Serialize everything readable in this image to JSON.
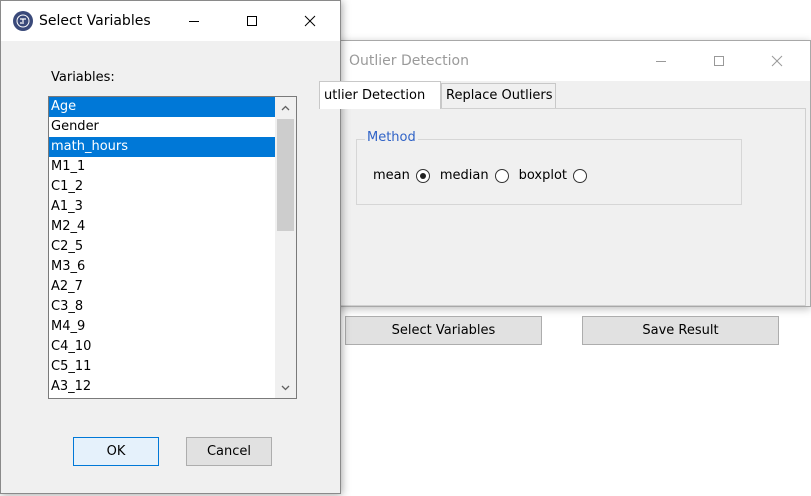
{
  "outlier_window": {
    "title": "Outlier Detection",
    "tabs": [
      {
        "label": "utlier Detection",
        "active": true
      },
      {
        "label": "Replace Outliers",
        "active": false
      }
    ],
    "method_group": {
      "title": "Method",
      "options": [
        {
          "label": "mean",
          "selected": true
        },
        {
          "label": "median",
          "selected": false
        },
        {
          "label": "boxplot",
          "selected": false
        }
      ]
    },
    "select_variables_label": "Select Variables",
    "save_result_label": "Save Result"
  },
  "select_window": {
    "title": "Select Variables",
    "variables_label": "Variables:",
    "variables": [
      {
        "name": "Age",
        "selected": true
      },
      {
        "name": "Gender",
        "selected": false
      },
      {
        "name": "math_hours",
        "selected": true
      },
      {
        "name": "M1_1",
        "selected": false
      },
      {
        "name": "C1_2",
        "selected": false
      },
      {
        "name": "A1_3",
        "selected": false
      },
      {
        "name": "M2_4",
        "selected": false
      },
      {
        "name": "C2_5",
        "selected": false
      },
      {
        "name": "M3_6",
        "selected": false
      },
      {
        "name": "A2_7",
        "selected": false
      },
      {
        "name": "C3_8",
        "selected": false
      },
      {
        "name": "M4_9",
        "selected": false
      },
      {
        "name": "C4_10",
        "selected": false
      },
      {
        "name": "C5_11",
        "selected": false
      },
      {
        "name": "A3_12",
        "selected": false
      }
    ],
    "ok_label": "OK",
    "cancel_label": "Cancel"
  },
  "colors": {
    "selection": "#0078d7",
    "group_title": "#3063c7",
    "window_bg": "#f0f0f0"
  },
  "icons": [
    "app-icon",
    "minimize-icon",
    "maximize-icon",
    "close-icon",
    "scroll-up-icon",
    "scroll-down-icon",
    "radio-icon"
  ]
}
